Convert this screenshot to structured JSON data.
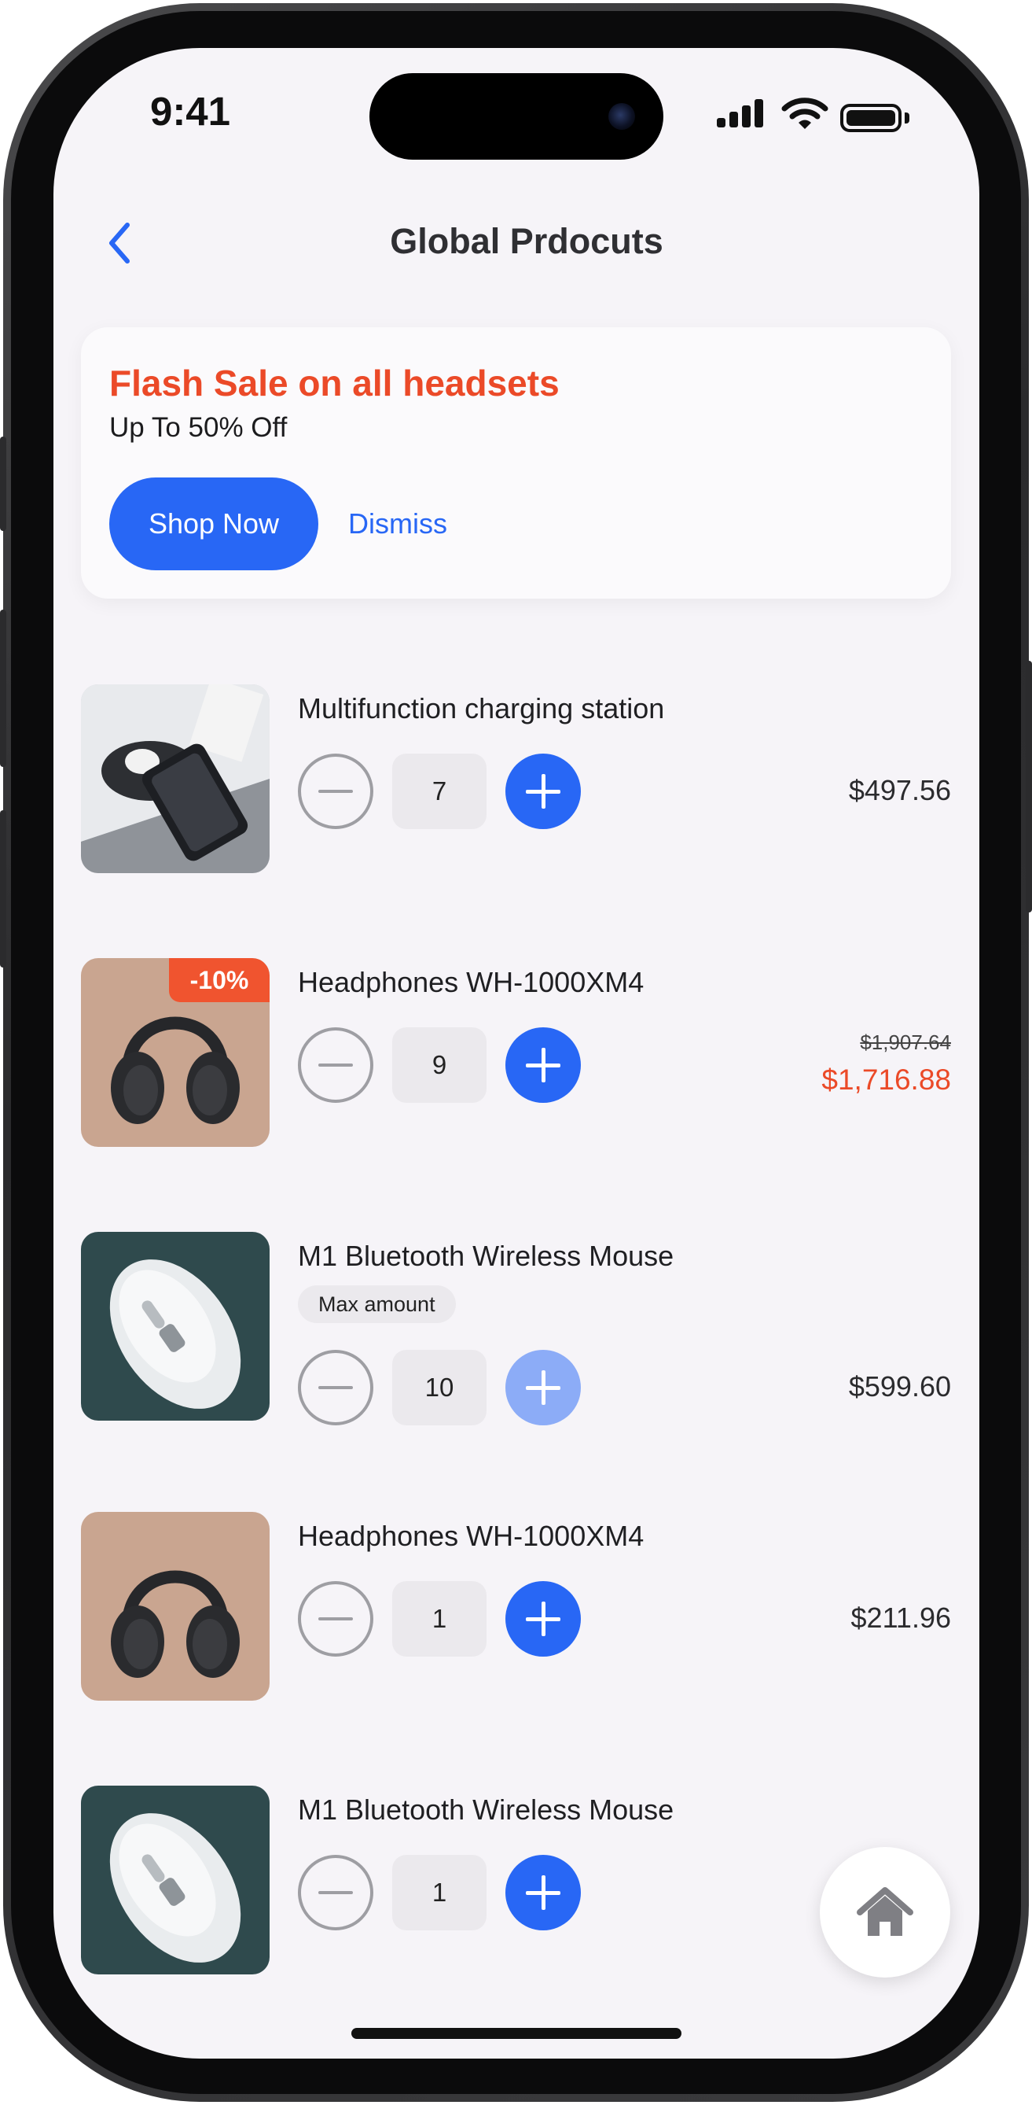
{
  "status_bar": {
    "time": "9:41"
  },
  "header": {
    "title": "Global Prdocuts"
  },
  "promo": {
    "title": "Flash Sale on all headsets",
    "subtitle": "Up To 50% Off",
    "primary_label": "Shop Now",
    "secondary_label": "Dismiss"
  },
  "products": [
    {
      "name": "Multifunction charging station",
      "quantity": "7",
      "price": "$497.56",
      "image": "charging-station"
    },
    {
      "name": "Headphones WH-1000XM4",
      "quantity": "9",
      "badge": "-10%",
      "price_original": "$1,907.64",
      "price": "$1,716.88",
      "image": "headphones"
    },
    {
      "name": "M1 Bluetooth Wireless Mouse",
      "quantity": "10",
      "note": "Max amount",
      "price": "$599.60",
      "image": "mouse",
      "plus_disabled": true
    },
    {
      "name": "Headphones WH-1000XM4",
      "quantity": "1",
      "price": "$211.96",
      "image": "headphones"
    },
    {
      "name": "M1 Bluetooth Wireless Mouse",
      "quantity": "1",
      "image": "mouse"
    }
  ],
  "colors": {
    "accent": "#2867f5",
    "sale": "#eb4a28",
    "background": "#f6f4f8"
  },
  "icons": [
    "chevron-left-icon",
    "signal-icon",
    "wifi-icon",
    "battery-icon",
    "home-icon"
  ]
}
